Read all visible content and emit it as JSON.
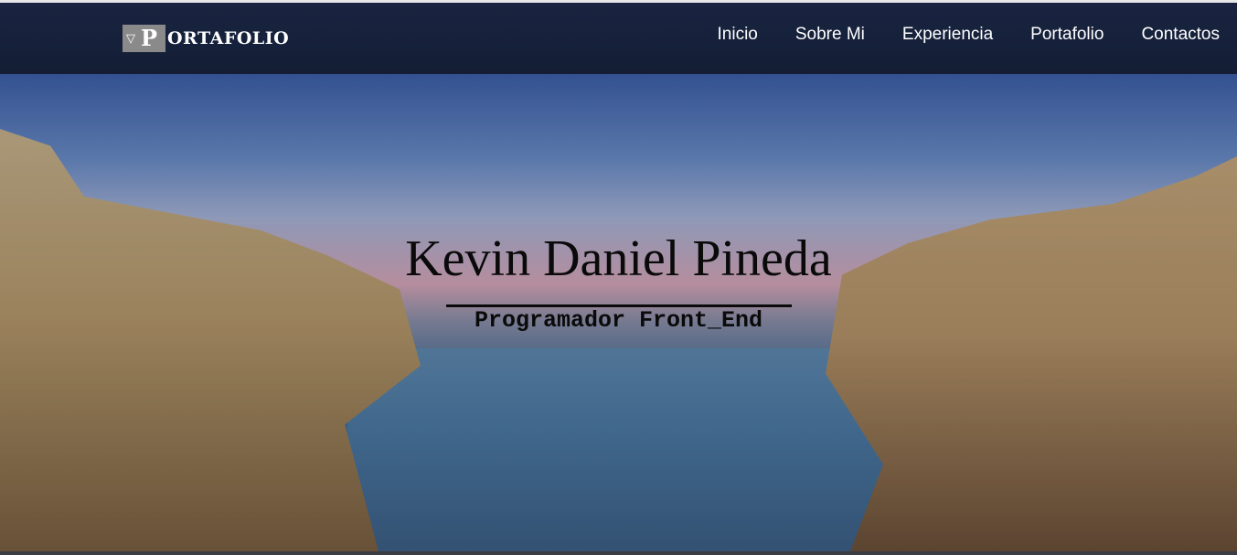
{
  "navbar": {
    "brand": {
      "caret_icon": "triangle-down-icon",
      "initial": "P",
      "rest": "ORTAFOLIO"
    },
    "items": [
      {
        "label": "Inicio"
      },
      {
        "label": "Sobre Mi"
      },
      {
        "label": "Experiencia"
      },
      {
        "label": "Portafolio"
      },
      {
        "label": "Contactos"
      }
    ]
  },
  "hero": {
    "title": "Kevin Daniel Pineda",
    "subtitle": "Programador Front_End"
  },
  "colors": {
    "navbar_bg": "#15203a",
    "brand_box": "#8a8a8a",
    "nav_text": "#ffffff",
    "hero_text": "#0a0a0a"
  }
}
